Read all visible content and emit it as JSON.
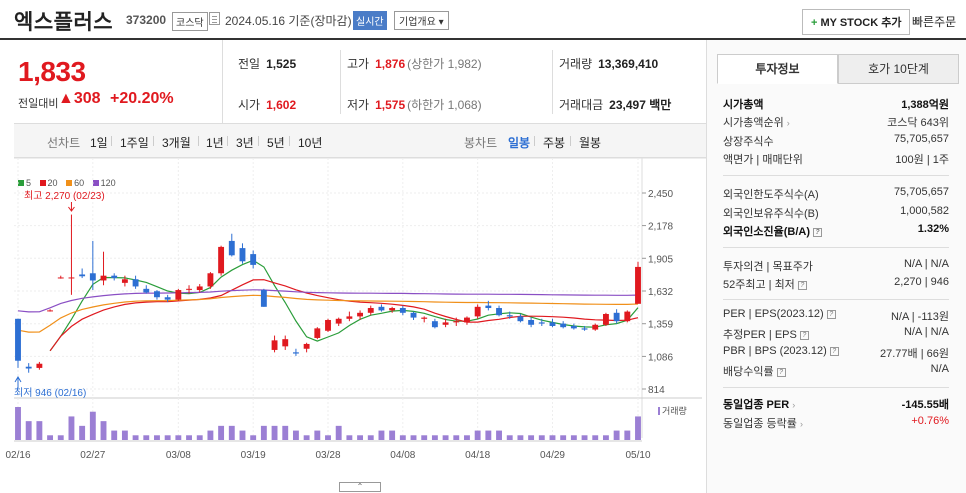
{
  "header": {
    "name": "엑스플러스",
    "code": "373200",
    "market": "코스닥",
    "date": "2024.05.16 기준(장마감)",
    "live_label": "실시간",
    "company_btn": "기업개요 ▾",
    "mystock_label": "MY STOCK 추가",
    "quick_order": "빠른주문"
  },
  "quote": {
    "price": "1,833",
    "change_label": "전일대비",
    "change": "▲308",
    "change_pct": "+20.20%",
    "prev_label": "전일",
    "prev": "1,525",
    "high_label": "고가",
    "high": "1,876",
    "upper_limit": "(상한가 1,982)",
    "volume_label": "거래량",
    "volume": "13,369,410",
    "open_label": "시가",
    "open": "1,602",
    "low_label": "저가",
    "low": "1,575",
    "lower_limit": "(하한가 1,068)",
    "amount_label": "거래대금",
    "amount": "23,497 백만"
  },
  "periods": {
    "line_label": "선차트",
    "line_items": [
      "1일",
      "1주일",
      "3개월",
      "1년",
      "3년",
      "5년",
      "10년"
    ],
    "candle_label": "봉차트",
    "candle_items": [
      "일봉",
      "주봉",
      "월봉"
    ],
    "active_candle": "일봉"
  },
  "legend": [
    {
      "label": "5",
      "color": "#2a9d3a"
    },
    {
      "label": "20",
      "color": "#e0191f"
    },
    {
      "label": "60",
      "color": "#f0901a"
    },
    {
      "label": "120",
      "color": "#8a4fc4"
    }
  ],
  "annotations": {
    "high": "최고 2,270 (02/23)",
    "low": "최저 946 (02/16)",
    "volume_label": "거래량"
  },
  "colors": {
    "up": "#e0191f",
    "down": "#2d6fd3",
    "volume": "#9b7fd4",
    "accent": "#2d6fd3"
  },
  "chart_data": {
    "type": "candlestick",
    "y_ticks": [
      "2,450",
      "2,178",
      "1,905",
      "1,632",
      "1,359",
      "1,086",
      "814"
    ],
    "ylim": [
      814,
      2450
    ],
    "x_ticks": [
      {
        "label": "02/16",
        "i": 0
      },
      {
        "label": "02/27",
        "i": 7
      },
      {
        "label": "03/08",
        "i": 15
      },
      {
        "label": "03/19",
        "i": 22
      },
      {
        "label": "03/28",
        "i": 29
      },
      {
        "label": "04/08",
        "i": 36
      },
      {
        "label": "04/18",
        "i": 43
      },
      {
        "label": "04/29",
        "i": 50
      },
      {
        "label": "05/10",
        "i": 58
      }
    ],
    "candles": [
      {
        "o": 1400,
        "h": 1400,
        "l": 990,
        "c": 1050
      },
      {
        "o": 1000,
        "h": 1030,
        "l": 950,
        "c": 985
      },
      {
        "o": 990,
        "h": 1040,
        "l": 975,
        "c": 1025
      },
      {
        "o": 1470,
        "h": 1480,
        "l": 1460,
        "c": 1470
      },
      {
        "o": 1745,
        "h": 1760,
        "l": 1735,
        "c": 1745
      },
      {
        "o": 1745,
        "h": 2270,
        "l": 1600,
        "c": 1745
      },
      {
        "o": 1770,
        "h": 1820,
        "l": 1740,
        "c": 1755
      },
      {
        "o": 1780,
        "h": 2050,
        "l": 1640,
        "c": 1720
      },
      {
        "o": 1720,
        "h": 1960,
        "l": 1680,
        "c": 1760
      },
      {
        "o": 1760,
        "h": 1780,
        "l": 1720,
        "c": 1740
      },
      {
        "o": 1700,
        "h": 1760,
        "l": 1670,
        "c": 1730
      },
      {
        "o": 1730,
        "h": 1760,
        "l": 1650,
        "c": 1670
      },
      {
        "o": 1650,
        "h": 1680,
        "l": 1610,
        "c": 1620
      },
      {
        "o": 1630,
        "h": 1640,
        "l": 1560,
        "c": 1580
      },
      {
        "o": 1580,
        "h": 1600,
        "l": 1540,
        "c": 1560
      },
      {
        "o": 1560,
        "h": 1650,
        "l": 1550,
        "c": 1640
      },
      {
        "o": 1650,
        "h": 1680,
        "l": 1610,
        "c": 1650
      },
      {
        "o": 1640,
        "h": 1690,
        "l": 1620,
        "c": 1670
      },
      {
        "o": 1670,
        "h": 1790,
        "l": 1650,
        "c": 1780
      },
      {
        "o": 1780,
        "h": 2010,
        "l": 1760,
        "c": 2000
      },
      {
        "o": 2050,
        "h": 2110,
        "l": 1920,
        "c": 1930
      },
      {
        "o": 1990,
        "h": 2030,
        "l": 1860,
        "c": 1880
      },
      {
        "o": 1940,
        "h": 1970,
        "l": 1820,
        "c": 1850
      },
      {
        "o": 1640,
        "h": 1650,
        "l": 1500,
        "c": 1500
      },
      {
        "o": 1140,
        "h": 1260,
        "l": 1120,
        "c": 1220
      },
      {
        "o": 1170,
        "h": 1260,
        "l": 1140,
        "c": 1230
      },
      {
        "o": 1120,
        "h": 1150,
        "l": 1090,
        "c": 1110
      },
      {
        "o": 1150,
        "h": 1200,
        "l": 1120,
        "c": 1190
      },
      {
        "o": 1240,
        "h": 1330,
        "l": 1230,
        "c": 1320
      },
      {
        "o": 1300,
        "h": 1400,
        "l": 1290,
        "c": 1390
      },
      {
        "o": 1360,
        "h": 1410,
        "l": 1340,
        "c": 1400
      },
      {
        "o": 1400,
        "h": 1460,
        "l": 1380,
        "c": 1420
      },
      {
        "o": 1420,
        "h": 1470,
        "l": 1390,
        "c": 1450
      },
      {
        "o": 1450,
        "h": 1510,
        "l": 1430,
        "c": 1490
      },
      {
        "o": 1500,
        "h": 1520,
        "l": 1460,
        "c": 1470
      },
      {
        "o": 1470,
        "h": 1500,
        "l": 1450,
        "c": 1490
      },
      {
        "o": 1490,
        "h": 1510,
        "l": 1430,
        "c": 1450
      },
      {
        "o": 1450,
        "h": 1460,
        "l": 1390,
        "c": 1410
      },
      {
        "o": 1400,
        "h": 1420,
        "l": 1370,
        "c": 1410
      },
      {
        "o": 1380,
        "h": 1400,
        "l": 1320,
        "c": 1330
      },
      {
        "o": 1350,
        "h": 1400,
        "l": 1330,
        "c": 1370
      },
      {
        "o": 1370,
        "h": 1410,
        "l": 1340,
        "c": 1380
      },
      {
        "o": 1370,
        "h": 1420,
        "l": 1350,
        "c": 1410
      },
      {
        "o": 1420,
        "h": 1520,
        "l": 1400,
        "c": 1500
      },
      {
        "o": 1510,
        "h": 1550,
        "l": 1470,
        "c": 1490
      },
      {
        "o": 1490,
        "h": 1510,
        "l": 1420,
        "c": 1430
      },
      {
        "o": 1430,
        "h": 1460,
        "l": 1400,
        "c": 1420
      },
      {
        "o": 1420,
        "h": 1440,
        "l": 1370,
        "c": 1380
      },
      {
        "o": 1390,
        "h": 1410,
        "l": 1330,
        "c": 1350
      },
      {
        "o": 1370,
        "h": 1400,
        "l": 1340,
        "c": 1360
      },
      {
        "o": 1370,
        "h": 1400,
        "l": 1330,
        "c": 1340
      },
      {
        "o": 1360,
        "h": 1380,
        "l": 1320,
        "c": 1330
      },
      {
        "o": 1340,
        "h": 1360,
        "l": 1310,
        "c": 1320
      },
      {
        "o": 1320,
        "h": 1340,
        "l": 1300,
        "c": 1310
      },
      {
        "o": 1310,
        "h": 1360,
        "l": 1300,
        "c": 1350
      },
      {
        "o": 1350,
        "h": 1450,
        "l": 1340,
        "c": 1440
      },
      {
        "o": 1450,
        "h": 1480,
        "l": 1360,
        "c": 1380
      },
      {
        "o": 1380,
        "h": 1470,
        "l": 1370,
        "c": 1460
      },
      {
        "o": 1525,
        "h": 1876,
        "l": 1575,
        "c": 1833
      }
    ],
    "volumes": [
      7,
      4,
      4,
      1,
      1,
      5,
      3,
      6,
      4,
      2,
      2,
      1,
      1,
      1,
      1,
      1,
      1,
      1,
      2,
      3,
      3,
      2,
      1,
      3,
      3,
      3,
      2,
      1,
      2,
      1,
      3,
      1,
      1,
      1,
      2,
      2,
      1,
      1,
      1,
      1,
      1,
      1,
      1,
      2,
      2,
      2,
      1,
      1,
      1,
      1,
      1,
      1,
      1,
      1,
      1,
      1,
      2,
      2,
      5
    ]
  },
  "side": {
    "tab_invest": "투자정보",
    "tab_hoga": "호가 10단계",
    "rows": {
      "mcap_l": "시가총액",
      "mcap_v": "1,388억원",
      "mrank_l": "시가총액순위",
      "mrank_v": "코스닥 643위",
      "shares_l": "상장주식수",
      "shares_v": "75,705,657",
      "par_l": "액면가 | 매매단위",
      "par_v": "100원 | 1주",
      "flimit_l": "외국인한도주식수(A)",
      "flimit_v": "75,705,657",
      "fhold_l": "외국인보유주식수(B)",
      "fhold_v": "1,000,582",
      "fratio_l": "외국인소진율(B/A)",
      "fratio_v": "1.32%",
      "opinion_l": "투자의견 | 목표주가",
      "opinion_v": "N/A | N/A",
      "w52_l": "52주최고 | 최저",
      "w52_v": "2,270 | 946",
      "per_l": "PER | EPS(2023.12)",
      "per_v": "N/A | -113원",
      "eper_l": "추정PER | EPS",
      "eper_v": "N/A | N/A",
      "pbr_l": "PBR | BPS (2023.12)",
      "pbr_v": "27.77배 | 66원",
      "div_l": "배당수익률",
      "div_v": "N/A",
      "sper_l": "동일업종 PER",
      "sper_v": "-145.55배",
      "srate_l": "동일업종 등락률",
      "srate_v": "+0.76%"
    }
  }
}
